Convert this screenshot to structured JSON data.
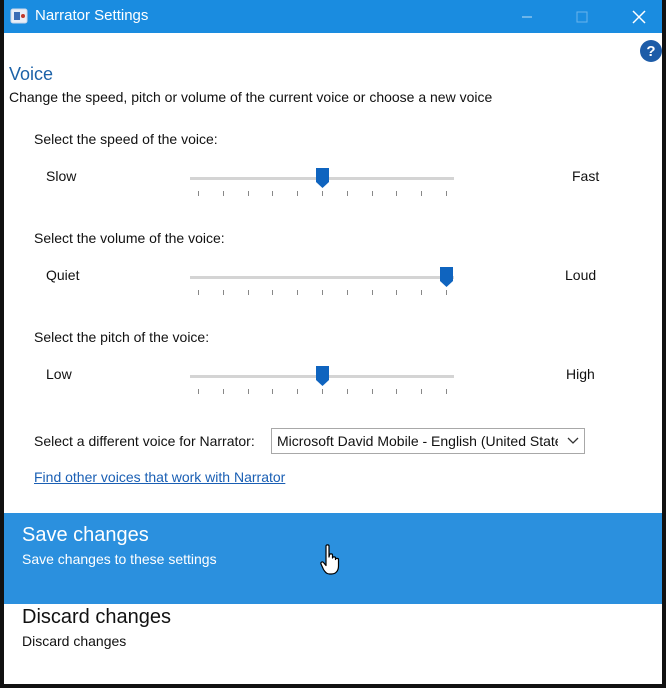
{
  "window": {
    "title": "Narrator Settings",
    "help_glyph": "?",
    "colors": {
      "titlebar": "#1a8ce0",
      "accent": "#1c62a8",
      "selected_panel": "#2b90de"
    }
  },
  "voice_section": {
    "title": "Voice",
    "description": "Change the speed, pitch or volume of the current voice or choose a new voice"
  },
  "sliders": [
    {
      "label": "Select the speed of the voice:",
      "min_label": "Slow",
      "max_label": "Fast",
      "value": 5,
      "max": 10
    },
    {
      "label": "Select the volume of the voice:",
      "min_label": "Quiet",
      "max_label": "Loud",
      "value": 10,
      "max": 10
    },
    {
      "label": "Select the pitch of the voice:",
      "min_label": "Low",
      "max_label": "High",
      "value": 5,
      "max": 10
    }
  ],
  "voice_select": {
    "label": "Select a different voice for Narrator:",
    "value": "Microsoft David Mobile - English (United States)"
  },
  "find_link": "Find other voices that work with Narrator",
  "actions": {
    "save": {
      "title": "Save changes",
      "subtitle": "Save changes to these settings"
    },
    "discard": {
      "title": "Discard changes",
      "subtitle": "Discard changes"
    }
  },
  "icons": {
    "app": "narrator-app-icon",
    "minimize": "minimize-icon",
    "maximize": "maximize-icon",
    "close": "close-icon",
    "help": "help-icon",
    "dropdown": "chevron-down-icon",
    "cursor": "hand-cursor-icon"
  }
}
